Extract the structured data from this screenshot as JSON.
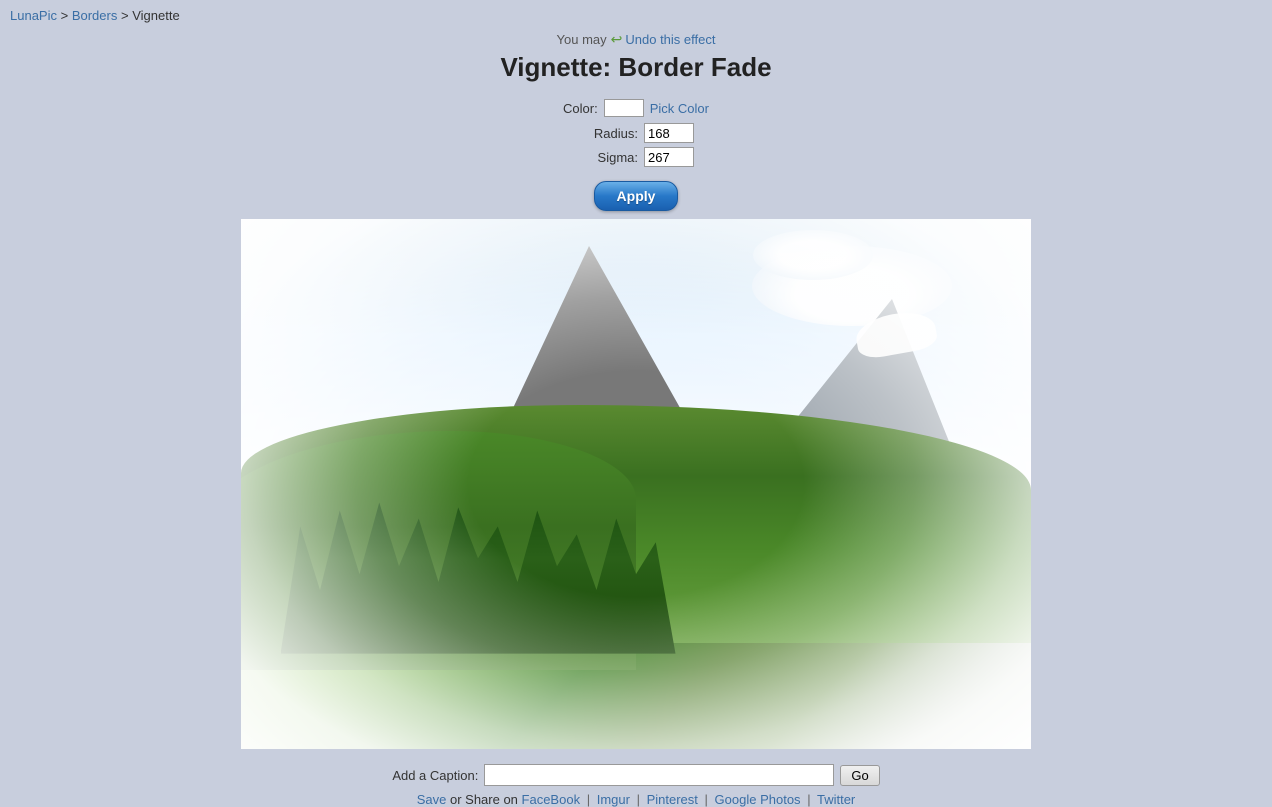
{
  "breadcrumb": {
    "lunapic": "LunaPic",
    "separator1": " > ",
    "borders": "Borders",
    "separator2": " > ",
    "current": "Vignette"
  },
  "header": {
    "undo_prefix": "You may",
    "undo_label": "Undo this effect",
    "title": "Vignette: Border Fade"
  },
  "controls": {
    "color_label": "Color:",
    "pick_color_label": "Pick Color",
    "radius_label": "Radius:",
    "radius_value": "168",
    "sigma_label": "Sigma:",
    "sigma_value": "267",
    "apply_label": "Apply"
  },
  "caption": {
    "label": "Add a Caption:",
    "placeholder": "",
    "go_label": "Go"
  },
  "share": {
    "save_label": "Save",
    "prefix": "or Share on",
    "facebook": "FaceBook",
    "imgur": "Imgur",
    "pinterest": "Pinterest",
    "google_photos": "Google Photos",
    "twitter": "Twitter"
  }
}
